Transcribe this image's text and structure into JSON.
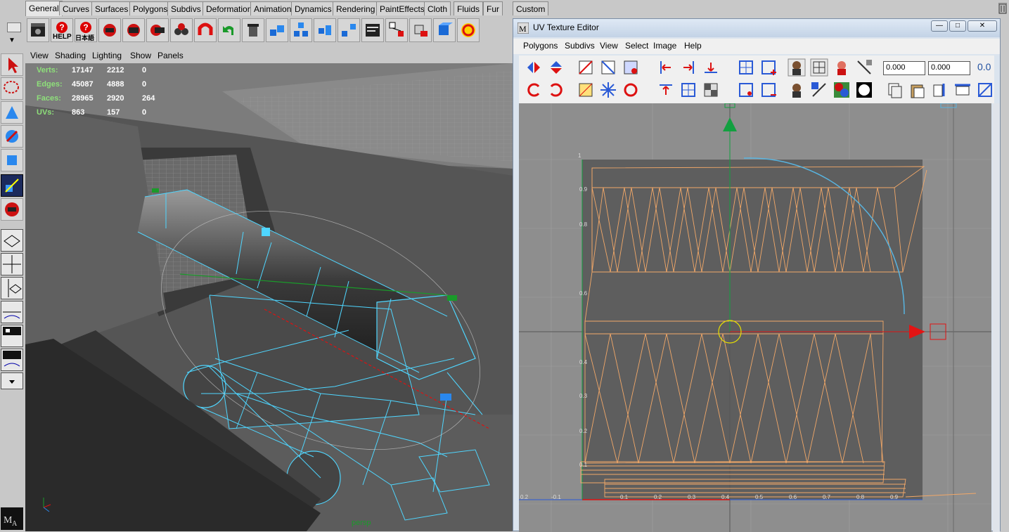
{
  "shelf": {
    "tabs": [
      "General",
      "Curves",
      "Surfaces",
      "Polygons",
      "Subdivs",
      "Deformation",
      "Animation",
      "Dynamics",
      "Rendering",
      "PaintEffects",
      "Cloth",
      "Fluids",
      "Fur",
      "Custom"
    ],
    "active_tab": "General",
    "help_label": "HELP",
    "help2_label": "日本語"
  },
  "viewport": {
    "menu": [
      "View",
      "Shading",
      "Lighting",
      "Show",
      "Panels"
    ],
    "hud": [
      {
        "label": "Verts:",
        "v1": "17147",
        "v2": "2212",
        "v3": "0"
      },
      {
        "label": "Edges:",
        "v1": "45087",
        "v2": "4888",
        "v3": "0"
      },
      {
        "label": "Faces:",
        "v1": "28965",
        "v2": "2920",
        "v3": "264"
      },
      {
        "label": "UVs:",
        "v1": "863",
        "v2": "157",
        "v3": "0"
      }
    ],
    "camera_label": "persp",
    "colors": {
      "wire": "#4fd6ff",
      "ground": "#8c8c8c"
    }
  },
  "uv_editor": {
    "title": "UV Texture Editor",
    "menu": [
      "Polygons",
      "Subdivs",
      "View",
      "Select",
      "Image",
      "Help"
    ],
    "u_field": "0.000",
    "v_field": "0.000",
    "uv_button": "0.0",
    "grid_labels": [
      "1",
      "0.9",
      "0.8",
      "0.6",
      "0.4",
      "0.3",
      "0.2",
      "0.1",
      "0.2",
      "0.3",
      "0.4",
      "0.5",
      "0.6",
      "0.7",
      "0.8",
      "0.9",
      "0.2",
      "-0.1",
      "-0.2",
      "0.1"
    ],
    "colors": {
      "uv_wire": "#f2a868",
      "manip_x": "#e21414",
      "manip_y": "#12a040",
      "rotate": "#58b4e0",
      "pivot": "#e8e000"
    }
  }
}
